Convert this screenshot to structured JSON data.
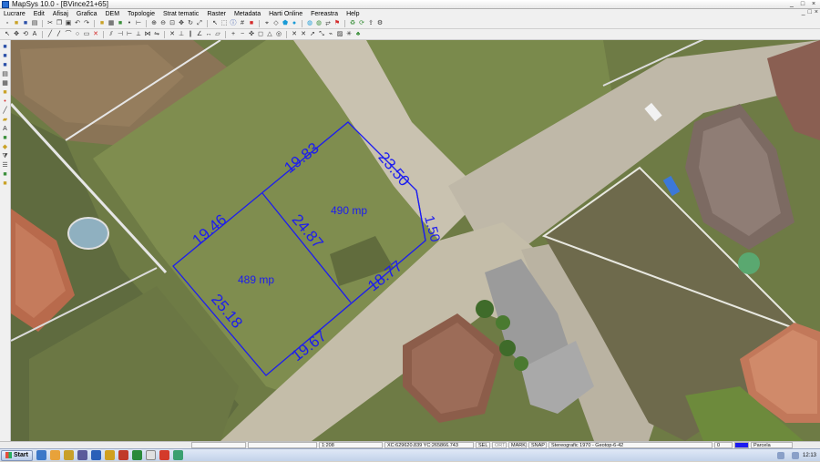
{
  "window": {
    "title": "MapSys 10.0 - [BVince21+65]"
  },
  "window_controls": [
    "_",
    "□",
    "×"
  ],
  "menu": [
    "Lucrare",
    "Edit",
    "Afisaj",
    "Grafica",
    "DEM",
    "Topologie",
    "Strat tematic",
    "Raster",
    "Metadata",
    "Harti Online",
    "Fereastra",
    "Help"
  ],
  "mdi_controls": [
    "_",
    "□",
    "×"
  ],
  "map": {
    "dimensions": [
      "19.83",
      "19.46",
      "23.50",
      "24.87",
      "1.50",
      "18.77",
      "25.18",
      "19.67"
    ],
    "areas": [
      "490 mp",
      "489 mp"
    ],
    "line_color": "#1c1cf0"
  },
  "status": {
    "scale": "1:208",
    "coords": "XC:629620.839 YC:265866.743",
    "flags": [
      "SEL",
      "ORT",
      "MARK",
      "SNAP"
    ],
    "projection": "Stereografic 1970 - Geotop-6-42",
    "layer_index": "0",
    "layer_name": "Parcela"
  },
  "taskbar": {
    "start_label": "Start",
    "clock": "12:13"
  }
}
